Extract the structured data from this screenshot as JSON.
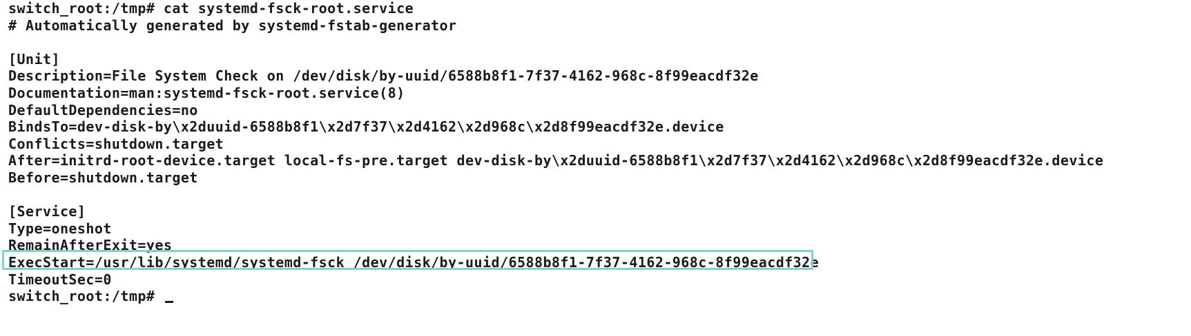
{
  "terminal": {
    "lines": [
      "switch_root:/tmp# cat systemd-fsck-root.service",
      "# Automatically generated by systemd-fstab-generator",
      "",
      "[Unit]",
      "Description=File System Check on /dev/disk/by-uuid/6588b8f1-7f37-4162-968c-8f99eacdf32e",
      "Documentation=man:systemd-fsck-root.service(8)",
      "DefaultDependencies=no",
      "BindsTo=dev-disk-by\\x2duuid-6588b8f1\\x2d7f37\\x2d4162\\x2d968c\\x2d8f99eacdf32e.device",
      "Conflicts=shutdown.target",
      "After=initrd-root-device.target local-fs-pre.target dev-disk-by\\x2duuid-6588b8f1\\x2d7f37\\x2d4162\\x2d968c\\x2d8f99eacdf32e.device",
      "Before=shutdown.target",
      "",
      "[Service]",
      "Type=oneshot",
      "RemainAfterExit=yes",
      "ExecStart=/usr/lib/systemd/systemd-fsck /dev/disk/by-uuid/6588b8f1-7f37-4162-968c-8f99eacdf32e",
      "TimeoutSec=0",
      "switch_root:/tmp# "
    ],
    "highlighted_line_index": 15,
    "colors": {
      "background": "#ffffff",
      "text": "#1a1a1a",
      "highlight_border": "#7fd3cc"
    }
  }
}
